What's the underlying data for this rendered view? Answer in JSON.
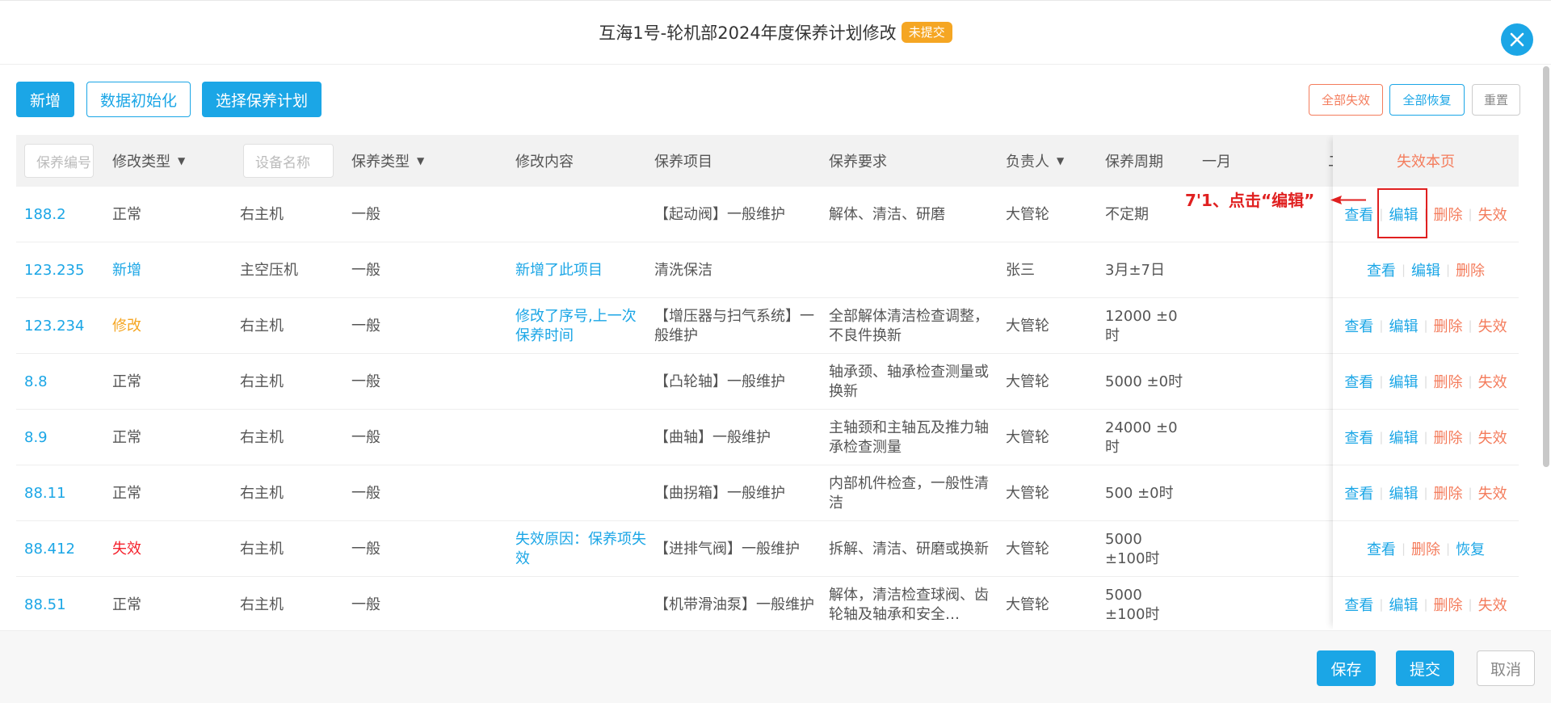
{
  "header": {
    "title": "互海1号-轮机部2024年度保养计划修改",
    "status_badge": "未提交"
  },
  "toolbar": {
    "add_label": "新增",
    "init_label": "数据初始化",
    "select_plan_label": "选择保养计划",
    "invalidate_all_label": "全部失效",
    "restore_all_label": "全部恢复",
    "reset_label": "重置"
  },
  "table": {
    "filters": {
      "code_placeholder": "保养编号",
      "device_placeholder": "设备名称"
    },
    "headers": {
      "modify_type": "修改类型",
      "maint_type": "保养类型",
      "modify_content": "修改内容",
      "item": "保养项目",
      "requirement": "保养要求",
      "owner": "负责人",
      "cycle": "保养周期",
      "jan": "一月",
      "feb_partial": "二"
    },
    "fixed_header": "失效本页",
    "rows": [
      {
        "code": "188.2",
        "type": "正常",
        "device": "右主机",
        "mtype": "一般",
        "content": "",
        "item": "【起动阀】一般维护",
        "req": "解体、清洁、研磨",
        "owner": "大管轮",
        "cycle": "不定期",
        "actions": [
          "查看",
          "编辑",
          "删除",
          "失效"
        ]
      },
      {
        "code": "123.235",
        "type": "新增",
        "device": "主空压机",
        "mtype": "一般",
        "content": "新增了此项目",
        "item": "清洗保洁",
        "req": "",
        "owner": "张三",
        "cycle": "3月±7日",
        "actions": [
          "查看",
          "编辑",
          "删除"
        ]
      },
      {
        "code": "123.234",
        "type": "修改",
        "device": "右主机",
        "mtype": "一般",
        "content": "修改了序号,上一次保养时间",
        "item": "【增压器与扫气系统】一般维护",
        "req": "全部解体清洁检查调整，不良件换新",
        "owner": "大管轮",
        "cycle": "12000 ±0时",
        "actions": [
          "查看",
          "编辑",
          "删除",
          "失效"
        ]
      },
      {
        "code": "8.8",
        "type": "正常",
        "device": "右主机",
        "mtype": "一般",
        "content": "",
        "item": "【凸轮轴】一般维护",
        "req": "轴承颈、轴承检查测量或换新",
        "owner": "大管轮",
        "cycle": "5000 ±0时",
        "actions": [
          "查看",
          "编辑",
          "删除",
          "失效"
        ]
      },
      {
        "code": "8.9",
        "type": "正常",
        "device": "右主机",
        "mtype": "一般",
        "content": "",
        "item": "【曲轴】一般维护",
        "req": "主轴颈和主轴瓦及推力轴承检查测量",
        "owner": "大管轮",
        "cycle": "24000 ±0时",
        "actions": [
          "查看",
          "编辑",
          "删除",
          "失效"
        ]
      },
      {
        "code": "88.11",
        "type": "正常",
        "device": "右主机",
        "mtype": "一般",
        "content": "",
        "item": "【曲拐箱】一般维护",
        "req": "内部机件检查，一般性清洁",
        "owner": "大管轮",
        "cycle": "500 ±0时",
        "actions": [
          "查看",
          "编辑",
          "删除",
          "失效"
        ]
      },
      {
        "code": "88.412",
        "type": "失效",
        "device": "右主机",
        "mtype": "一般",
        "content": "失效原因：保养项失效",
        "item": "【进排气阀】一般维护",
        "req": "拆解、清洁、研磨或换新",
        "owner": "大管轮",
        "cycle": "5000 ±100时",
        "actions": [
          "查看",
          "删除",
          "恢复"
        ]
      },
      {
        "code": "88.51",
        "type": "正常",
        "device": "右主机",
        "mtype": "一般",
        "content": "",
        "item": "【机带滑油泵】一般维护",
        "req": "解体，清洁检查球阀、齿轮轴及轴承和安全…",
        "owner": "大管轮",
        "cycle": "5000 ±100时",
        "actions": [
          "查看",
          "编辑",
          "删除",
          "失效"
        ]
      }
    ]
  },
  "annotation": {
    "text": "7'1、点击“编辑”"
  },
  "footer": {
    "save_label": "保存",
    "submit_label": "提交",
    "cancel_label": "取消"
  },
  "colors": {
    "primary": "#1ba6e6",
    "warning": "#f5a623",
    "danger": "#f5222d",
    "soft_danger": "#f47c5c",
    "annotation": "#e02020"
  }
}
